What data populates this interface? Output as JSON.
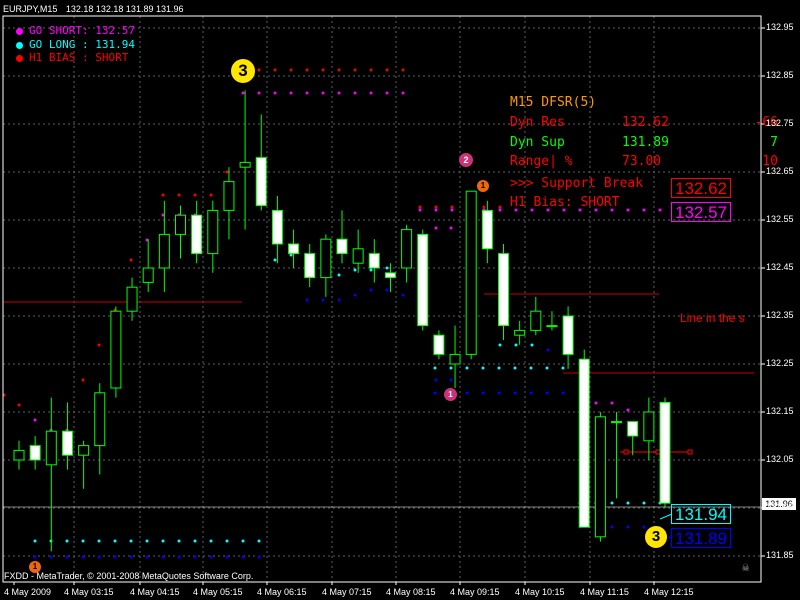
{
  "window": {
    "symbol_timeframe": "EURJPY,M15",
    "ohlc_readout": "132.18 132.18 131.89 131.96",
    "copyright": "FXDD - MetaTrader, © 2001-2008 MetaQuotes Software Corp."
  },
  "legend": [
    {
      "label": "GO SHORT: 132.57",
      "color": "#ff00ff"
    },
    {
      "label": "GO LONG : 131.94",
      "color": "#00ffff"
    },
    {
      "label": "H1 BIAS : SHORT",
      "color": "#ff0000"
    }
  ],
  "panel": {
    "title": "M15 DFSR(5)",
    "title_color": "#ff9900",
    "rows": [
      {
        "label": "Dyn Res",
        "value": "132.62",
        "count": "-66",
        "color": "#ff0000"
      },
      {
        "label": "Dyn Sup",
        "value": "131.89",
        "count": "7",
        "color": "#00ff00"
      },
      {
        "label": "Range| %",
        "value": "73.00",
        "count": "10",
        "color": "#ff0000"
      }
    ],
    "support_text": ">>> Support Break",
    "bias_text": "H1 Bias: SHORT",
    "line_label": "Line in the s"
  },
  "price_boxes": [
    {
      "value": "132.62",
      "color": "#ff0000"
    },
    {
      "value": "132.57",
      "color": "#ff00ff"
    },
    {
      "value": "131.94",
      "color": "#00ffff"
    },
    {
      "value": "131.89",
      "color": "#0000ff"
    }
  ],
  "current_price_label": "131.96",
  "badges": [
    {
      "text": "3",
      "kind": "big"
    },
    {
      "text": "3",
      "kind": "big"
    },
    {
      "text": "2",
      "kind": "small"
    },
    {
      "text": "1",
      "kind": "small"
    },
    {
      "text": "1",
      "kind": "small"
    },
    {
      "text": "1",
      "kind": "small"
    }
  ],
  "chart_data": {
    "type": "candlestick",
    "title": "EURJPY,M15",
    "y_ticks": [
      "132.95",
      "132.85",
      "132.75",
      "132.65",
      "132.55",
      "132.45",
      "132.35",
      "132.25",
      "132.15",
      "132.05",
      "131.95",
      "131.85"
    ],
    "ylim": [
      131.82,
      132.97
    ],
    "x_ticks": [
      "4 May 2009",
      "4 May 03:15",
      "4 May 04:15",
      "4 May 05:15",
      "4 May 06:15",
      "4 May 07:15",
      "4 May 08:15",
      "4 May 09:15",
      "4 May 10:15",
      "4 May 11:15",
      "4 May 12:15"
    ],
    "current_price": 131.96,
    "up_color": "#00ff00",
    "down_color": "#ffffff",
    "candles": [
      [
        132.05,
        132.09,
        132.03,
        132.07
      ],
      [
        132.08,
        132.1,
        132.03,
        132.05
      ],
      [
        132.04,
        132.18,
        131.86,
        132.11
      ],
      [
        132.11,
        132.17,
        132.03,
        132.06
      ],
      [
        132.06,
        132.09,
        131.99,
        132.08
      ],
      [
        132.08,
        132.21,
        132.02,
        132.19
      ],
      [
        132.2,
        132.37,
        132.18,
        132.36
      ],
      [
        132.36,
        132.43,
        132.34,
        132.41
      ],
      [
        132.42,
        132.51,
        132.4,
        132.45
      ],
      [
        132.45,
        132.59,
        132.4,
        132.52
      ],
      [
        132.52,
        132.58,
        132.47,
        132.56
      ],
      [
        132.56,
        132.59,
        132.46,
        132.48
      ],
      [
        132.48,
        132.59,
        132.44,
        132.57
      ],
      [
        132.57,
        132.66,
        132.51,
        132.63
      ],
      [
        132.66,
        132.82,
        132.53,
        132.67
      ],
      [
        132.68,
        132.77,
        132.57,
        132.58
      ],
      [
        132.57,
        132.6,
        132.46,
        132.5
      ],
      [
        132.5,
        132.53,
        132.45,
        132.48
      ],
      [
        132.48,
        132.5,
        132.41,
        132.43
      ],
      [
        132.43,
        132.52,
        132.39,
        132.51
      ],
      [
        132.51,
        132.57,
        132.46,
        132.48
      ],
      [
        132.46,
        132.53,
        132.44,
        132.49
      ],
      [
        132.48,
        132.51,
        132.42,
        132.45
      ],
      [
        132.44,
        132.46,
        132.4,
        132.43
      ],
      [
        132.45,
        132.54,
        132.42,
        132.53
      ],
      [
        132.52,
        132.53,
        132.32,
        132.33
      ],
      [
        132.31,
        132.32,
        132.26,
        132.27
      ],
      [
        132.25,
        132.33,
        132.2,
        132.27
      ],
      [
        132.27,
        132.61,
        132.26,
        132.61
      ],
      [
        132.57,
        132.59,
        132.46,
        132.49
      ],
      [
        132.48,
        132.5,
        132.3,
        132.33
      ],
      [
        132.31,
        132.34,
        132.29,
        132.32
      ],
      [
        132.32,
        132.39,
        132.31,
        132.36
      ],
      [
        132.33,
        132.36,
        132.32,
        132.33
      ],
      [
        132.35,
        132.37,
        132.24,
        132.27
      ],
      [
        132.26,
        132.28,
        131.91,
        131.91
      ],
      [
        131.89,
        132.15,
        131.88,
        132.14
      ],
      [
        132.13,
        132.15,
        131.97,
        132.13
      ],
      [
        132.13,
        132.13,
        132.06,
        132.1
      ],
      [
        132.09,
        132.18,
        132.05,
        132.15
      ],
      [
        132.17,
        132.18,
        131.95,
        131.96
      ]
    ],
    "indicators": {
      "H1 BIAS red dots": 132.57,
      "GO SHORT magenta dots": 132.57,
      "GO LONG cyan dots": 131.94,
      "support blue dots": 131.89,
      "Dyn Res": 132.62,
      "Dyn Sup": 131.89
    }
  }
}
